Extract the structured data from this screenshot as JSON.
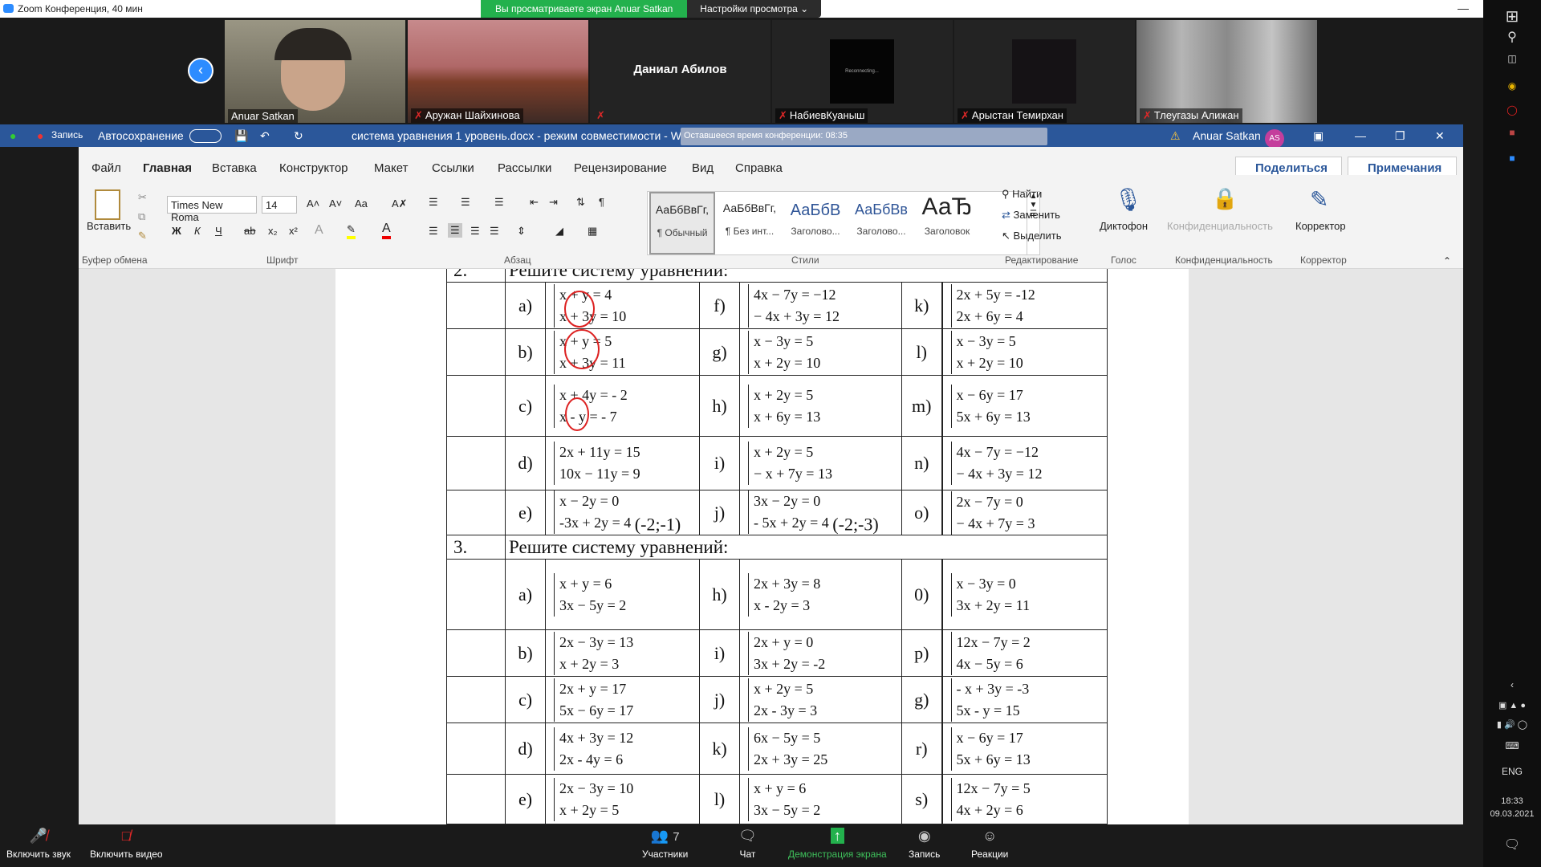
{
  "zoom": {
    "window_title": "Zoom Конференция, 40 мин",
    "banner_viewing": "Вы просматриваете экран Anuar Satkan",
    "banner_settings": "Настройки просмотра ⌄",
    "participants": [
      {
        "name": "Anuar Satkan"
      },
      {
        "name": "Аружан Шайхинова"
      },
      {
        "name": "Даниал Абилов"
      },
      {
        "name": "НабиевКуаныш"
      },
      {
        "name": "Арыстан Темирхан"
      },
      {
        "name": "Тлеугазы Алижан"
      }
    ],
    "reconnecting": "Reconnecting...",
    "toolbar": {
      "mute": "Включить звук",
      "video": "Включить видео",
      "participants": "Участники",
      "participants_count": "7",
      "chat": "Чат",
      "share": "Демонстрация экрана",
      "record": "Запись",
      "reactions": "Реакции"
    },
    "remaining_time": "Оставшееся время конференции: 08:35"
  },
  "word": {
    "record": "Запись",
    "autosave": "Автосохранение",
    "doc_title": "система уравнения 1 уровень.docx - режим совместимости - W",
    "user": "Anuar Satkan",
    "user_initials": "AS",
    "menu": [
      "Файл",
      "Главная",
      "Вставка",
      "Конструктор",
      "Макет",
      "Ссылки",
      "Рассылки",
      "Рецензирование",
      "Вид",
      "Справка"
    ],
    "share": "Поделиться",
    "notes": "Примечания",
    "font_name": "Times New Roma",
    "font_size": "14",
    "paste": "Вставить",
    "groups": {
      "clipboard": "Буфер обмена",
      "font": "Шрифт",
      "paragraph": "Абзац",
      "styles": "Стили",
      "editing": "Редактирование",
      "voice": "Голос",
      "privacy": "Конфиденциальность",
      "editor": "Корректор"
    },
    "styles": [
      {
        "preview": "АаБбВвГг,",
        "label": "¶ Обычный"
      },
      {
        "preview": "АаБбВвГг,",
        "label": "¶ Без инт..."
      },
      {
        "preview": "АаБбВ",
        "label": "Заголово..."
      },
      {
        "preview": "АаБбВв",
        "label": "Заголово..."
      },
      {
        "preview": "АаЂ",
        "label": "Заголовок"
      }
    ],
    "find": "Найти",
    "replace": "Заменить",
    "select": "Выделить",
    "dictate": "Диктофон",
    "privacy_btn": "Конфиденциальность",
    "editor_btn": "Корректор"
  },
  "doc": {
    "h2_num": "2.",
    "h2": "Решите систему уравнений:",
    "h3_num": "3.",
    "h3": "Решите систему уравнений:",
    "rows2": [
      {
        "l1": "a)",
        "s1": [
          "x + y = 4",
          "x + 3y = 10"
        ],
        "l2": "f)",
        "s2": [
          "4x − 7y = −12",
          "− 4x + 3y = 12"
        ],
        "l3": "k)",
        "s3": [
          "2x + 5y = -12",
          "2x + 6y = 4"
        ]
      },
      {
        "l1": "b)",
        "s1": [
          "x + y = 5",
          "x + 3y = 11"
        ],
        "l2": "g)",
        "s2": [
          "x − 3y = 5",
          "x + 2y = 10"
        ],
        "l3": "l)",
        "s3": [
          "x − 3y = 5",
          "x + 2y = 10"
        ]
      },
      {
        "l1": "c)",
        "s1": [
          "x + 4y = - 2",
          "x - y = - 7"
        ],
        "l2": "h)",
        "s2": [
          "x + 2y = 5",
          "x + 6y = 13"
        ],
        "l3": "m)",
        "s3": [
          "x − 6y = 17",
          "5x + 6y = 13"
        ]
      },
      {
        "l1": "d)",
        "s1": [
          "2x + 11y = 15",
          "10x − 11y = 9"
        ],
        "l2": "i)",
        "s2": [
          "x + 2y = 5",
          "− x + 7y = 13"
        ],
        "l3": "n)",
        "s3": [
          "4x − 7y = −12",
          "− 4x + 3y = 12"
        ]
      },
      {
        "l1": "e)",
        "s1": [
          "x − 2y = 0",
          "-3x + 2y = 4"
        ],
        "a1": "(-2;-1)",
        "l2": "j)",
        "s2": [
          "3x − 2y = 0",
          "- 5x + 2y = 4"
        ],
        "a2": "(-2;-3)",
        "l3": "o)",
        "s3": [
          "2x − 7y = 0",
          "− 4x + 7y = 3"
        ]
      }
    ],
    "rows3": [
      {
        "l1": "a)",
        "s1": [
          "x + y = 6",
          "3x − 5y = 2"
        ],
        "l2": "h)",
        "s2": [
          "2x + 3y = 8",
          "x - 2y = 3"
        ],
        "l3": "0)",
        "s3": [
          "x − 3y = 0",
          "3x + 2y = 11"
        ]
      },
      {
        "l1": "b)",
        "s1": [
          "2x − 3y = 13",
          "x + 2y = 3"
        ],
        "l2": "i)",
        "s2": [
          "2x + y = 0",
          "3x + 2y = -2"
        ],
        "l3": "p)",
        "s3": [
          "12x − 7y = 2",
          "4x − 5y = 6"
        ]
      },
      {
        "l1": "c)",
        "s1": [
          "2x + y = 17",
          "5x − 6y = 17"
        ],
        "l2": "j)",
        "s2": [
          "x + 2y = 5",
          "2x - 3y = 3"
        ],
        "l3": "g)",
        "s3": [
          "- x + 3y = -3",
          "5x - y = 15"
        ]
      },
      {
        "l1": "d)",
        "s1": [
          "4x + 3y = 12",
          "2x - 4y = 6"
        ],
        "l2": "k)",
        "s2": [
          "6x − 5y = 5",
          "2x + 3y = 25"
        ],
        "l3": "r)",
        "s3": [
          "x − 6y = 17",
          "5x + 6y = 13"
        ]
      },
      {
        "l1": "e)",
        "s1": [
          "2x − 3y = 10",
          "x + 2y = 5"
        ],
        "l2": "l)",
        "s2": [
          "x + y = 6",
          "3x − 5y = 2"
        ],
        "l3": "s)",
        "s3": [
          "12x − 7y = 5",
          "4x + 2y = 6"
        ]
      }
    ]
  },
  "taskbar": {
    "lang": "ENG",
    "time": "18:33",
    "date": "09.03.2021"
  }
}
